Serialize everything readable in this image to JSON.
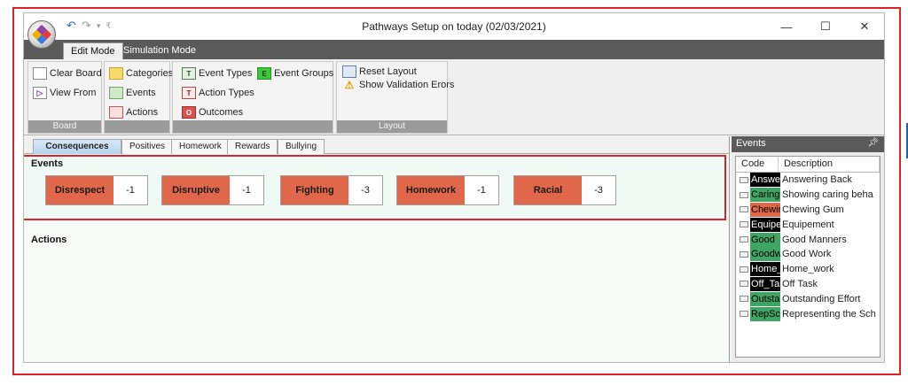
{
  "window": {
    "title": "Pathways Setup on today (02/03/2021)",
    "controls": [
      "—",
      "☐",
      "✕"
    ]
  },
  "ribbon_tabs": [
    {
      "label": "Edit Mode",
      "active": true
    },
    {
      "label": "Simulation Mode",
      "active": false
    }
  ],
  "ribbon": {
    "board": {
      "label": "Board",
      "clear_board": "Clear Board",
      "view_from": "View From"
    },
    "editors": {
      "categories": "Categories",
      "events": "Events",
      "actions": "Actions"
    },
    "types": {
      "event_types": "Event Types",
      "event_groups": "Event Groups",
      "action_types": "Action Types",
      "outcomes": "Outcomes"
    },
    "layout": {
      "label": "Layout",
      "reset_layout": "Reset Layout",
      "show_validation_errors": "Show Validation Erors"
    }
  },
  "board_tabs": [
    {
      "label": "Consequences",
      "active": true
    },
    {
      "label": "Positives",
      "active": false
    },
    {
      "label": "Homework",
      "active": false
    },
    {
      "label": "Rewards",
      "active": false
    },
    {
      "label": "Bullying",
      "active": false
    }
  ],
  "events_section": {
    "title": "Events",
    "cards": [
      {
        "name": "Disrespect",
        "value": "-1"
      },
      {
        "name": "Disruptive",
        "value": "-1"
      },
      {
        "name": "Fighting",
        "value": "-3"
      },
      {
        "name": "Homework",
        "value": "-1"
      },
      {
        "name": "Racial",
        "value": "-3"
      }
    ]
  },
  "actions_section": {
    "title": "Actions"
  },
  "events_panel": {
    "title": "Events",
    "pin_icon": "pin-icon",
    "columns": [
      "Code",
      "Description"
    ],
    "rows": [
      {
        "code": "Answer",
        "description": "Answering Back",
        "bg": "#000000",
        "fg": "#ffffff"
      },
      {
        "code": "Caring",
        "description": "Showing caring beha",
        "bg": "#3fa565",
        "fg": "#000000"
      },
      {
        "code": "Chewin",
        "description": "Chewing Gum",
        "bg": "#e0674a",
        "fg": "#000000"
      },
      {
        "code": "Equipe",
        "description": "Equipement",
        "bg": "#000000",
        "fg": "#ffffff"
      },
      {
        "code": "Good",
        "description": "Good Manners",
        "bg": "#3fa565",
        "fg": "#000000"
      },
      {
        "code": "Goodw",
        "description": "Good Work",
        "bg": "#3fa565",
        "fg": "#000000"
      },
      {
        "code": "Home_",
        "description": "Home_work",
        "bg": "#000000",
        "fg": "#ffffff"
      },
      {
        "code": "Off_Tas",
        "description": "Off Task",
        "bg": "#000000",
        "fg": "#ffffff"
      },
      {
        "code": "Outsta",
        "description": "Outstanding Effort",
        "bg": "#3fa565",
        "fg": "#000000"
      },
      {
        "code": "RepSch",
        "description": "Representing the Sch",
        "bg": "#3fa565",
        "fg": "#000000"
      }
    ]
  },
  "colors": {
    "highlight_border": "#d9222a",
    "event_card": "#e0674a"
  }
}
